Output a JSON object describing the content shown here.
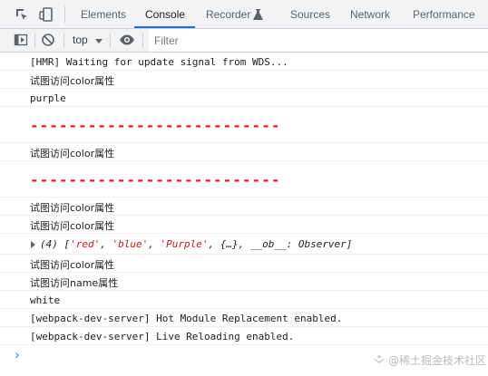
{
  "tabs": [
    {
      "label": "Elements",
      "active": false
    },
    {
      "label": "Console",
      "active": true
    },
    {
      "label": "Recorder",
      "active": false
    },
    {
      "label": "Sources",
      "active": false
    },
    {
      "label": "Network",
      "active": false
    },
    {
      "label": "Performance",
      "active": false
    }
  ],
  "toolbar": {
    "context": "top",
    "filter_placeholder": "Filter",
    "filter_value": ""
  },
  "console": {
    "lines": [
      {
        "type": "log",
        "text": "[HMR] Waiting for update signal from WDS..."
      },
      {
        "type": "log",
        "text": "试图访问color属性"
      },
      {
        "type": "log",
        "text": "purple"
      },
      {
        "type": "separator",
        "text": "--------------------------"
      },
      {
        "type": "log",
        "text": "试图访问color属性"
      },
      {
        "type": "separator",
        "text": "--------------------------"
      },
      {
        "type": "log",
        "text": "试图访问color属性"
      },
      {
        "type": "log",
        "text": "试图访问color属性"
      },
      {
        "type": "object",
        "parts": [
          "(4) [",
          "'red'",
          ", ",
          "'blue'",
          ", ",
          "'Purple'",
          ", {…}, __ob__: Observer]"
        ]
      },
      {
        "type": "log",
        "text": "试图访问color属性"
      },
      {
        "type": "log",
        "text": "试图访问name属性"
      },
      {
        "type": "log",
        "text": "white"
      },
      {
        "type": "log",
        "text": "[webpack-dev-server] Hot Module Replacement enabled."
      },
      {
        "type": "log",
        "text": "[webpack-dev-server] Live Reloading enabled."
      }
    ],
    "prompt": "›"
  },
  "watermark": "@稀土掘金技术社区",
  "colors": {
    "accent": "#1a73e8",
    "separator": "#e8201c",
    "string": "#c41a16"
  },
  "icons": [
    "inspect-element-icon",
    "device-toggle-icon",
    "recorder-flask-icon",
    "sidebar-toggle-icon",
    "clear-console-icon",
    "eye-icon"
  ]
}
